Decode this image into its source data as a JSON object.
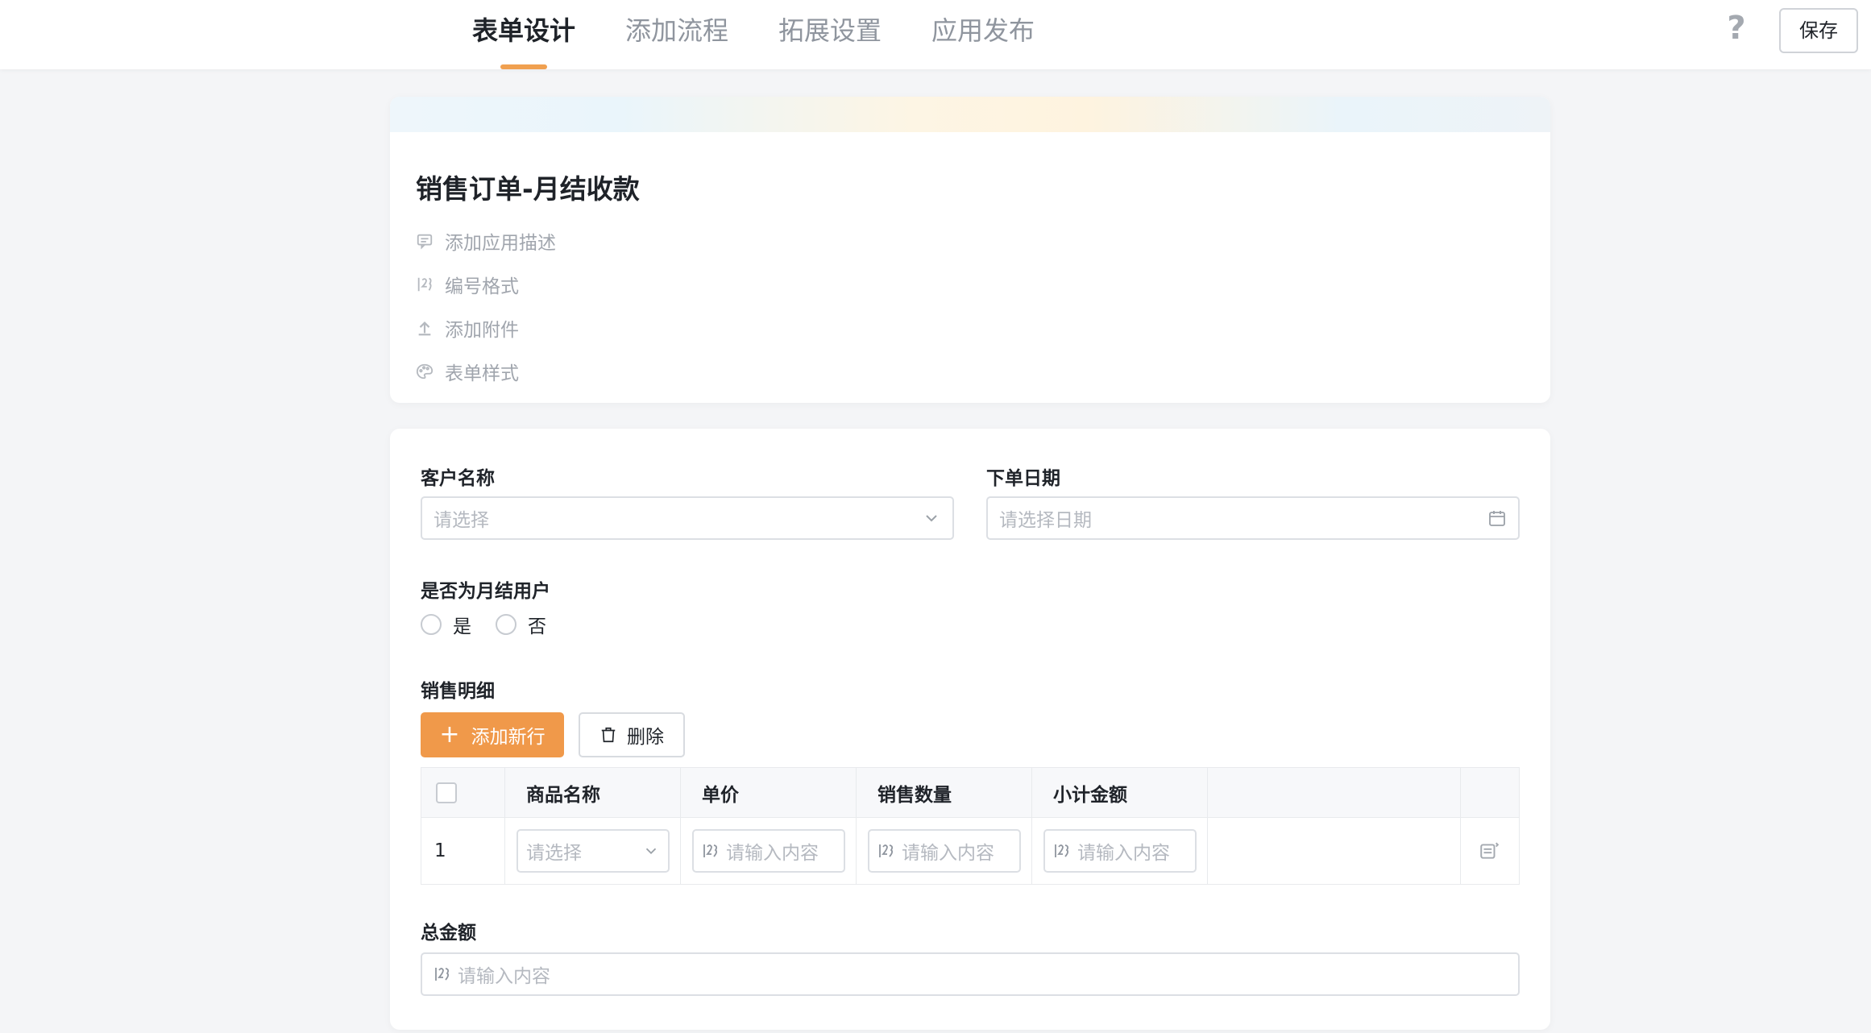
{
  "topbar": {
    "tabs": [
      {
        "label": "表单设计",
        "active": true
      },
      {
        "label": "添加流程",
        "active": false
      },
      {
        "label": "拓展设置",
        "active": false
      },
      {
        "label": "应用发布",
        "active": false
      }
    ],
    "help_label": "?",
    "save_label": "保存",
    "accent_color": "#f0a050"
  },
  "header": {
    "title": "销售订单-月结收款",
    "items": [
      {
        "label": "添加应用描述",
        "icon": "comment-icon"
      },
      {
        "label": "编号格式",
        "icon": "number-format-icon"
      },
      {
        "label": "添加附件",
        "icon": "upload-icon"
      },
      {
        "label": "表单样式",
        "icon": "palette-icon"
      }
    ]
  },
  "form": {
    "customer": {
      "label": "客户名称",
      "placeholder": "请选择"
    },
    "order_date": {
      "label": "下单日期",
      "placeholder": "请选择日期"
    },
    "monthly_user": {
      "label": "是否为月结用户",
      "options": [
        "是",
        "否"
      ]
    },
    "details": {
      "label": "销售明细",
      "add_button": "添加新行",
      "delete_button": "删除",
      "columns": [
        "商品名称",
        "单价",
        "销售数量",
        "小计金额"
      ],
      "rows": [
        {
          "index": "1",
          "product_placeholder": "请选择",
          "price_placeholder": "请输入内容",
          "qty_placeholder": "请输入内容",
          "subtotal_placeholder": "请输入内容"
        }
      ]
    },
    "total": {
      "label": "总金额",
      "placeholder": "请输入内容"
    },
    "primary_color": "#f0994a"
  }
}
